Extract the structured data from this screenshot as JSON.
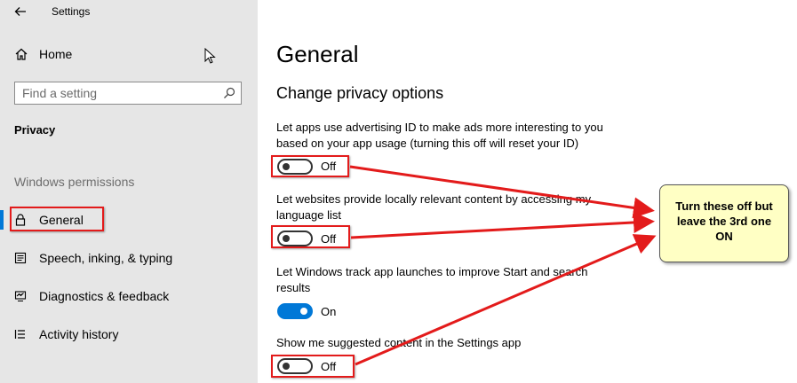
{
  "window": {
    "title": "Settings"
  },
  "sidebar": {
    "home_label": "Home",
    "search_placeholder": "Find a setting",
    "section_title": "Privacy",
    "group_title": "Windows permissions",
    "items": [
      {
        "label": "General",
        "icon": "lock-icon",
        "selected": true
      },
      {
        "label": "Speech, inking, & typing",
        "icon": "speech-icon"
      },
      {
        "label": "Diagnostics & feedback",
        "icon": "diagnostics-icon"
      },
      {
        "label": "Activity history",
        "icon": "activity-history-icon"
      }
    ]
  },
  "main": {
    "title": "General",
    "subtitle": "Change privacy options",
    "settings": [
      {
        "text_line1": "Let apps use advertising ID to make ads more interesting to you",
        "text_line2": "based on your app usage (turning this off will reset your ID)",
        "state": "Off",
        "on": false
      },
      {
        "text_line1": "Let websites provide locally relevant content by accessing my",
        "text_line2": "language list",
        "state": "Off",
        "on": false
      },
      {
        "text_line1": "Let Windows track app launches to improve Start and search",
        "text_line2": "results",
        "state": "On",
        "on": true
      },
      {
        "text_line1": "Show me suggested content in the Settings app",
        "text_line2": "",
        "state": "Off",
        "on": false
      }
    ]
  },
  "annotation": {
    "line1": "Turn these off but",
    "line2": "leave the 3rd one",
    "line3": "ON"
  },
  "colors": {
    "sidebar_bg": "#e6e6e6",
    "accent": "#0078d7",
    "annotation_red": "#e31b1b",
    "callout_bg": "#ffffc4"
  }
}
